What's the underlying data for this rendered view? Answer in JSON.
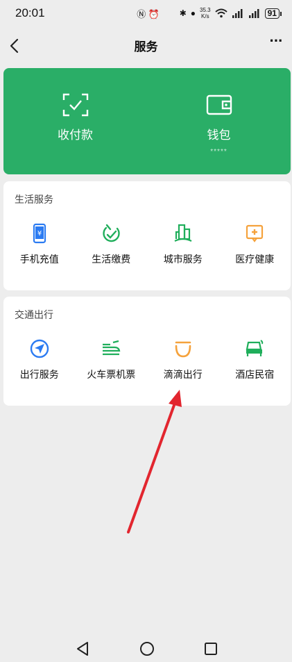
{
  "status_bar": {
    "time": "20:01",
    "nfc_alarm": "Ⓝ ⏰",
    "speed_value": "35.3",
    "speed_unit": "K/s",
    "battery": "91"
  },
  "nav": {
    "title": "服务",
    "more": "···"
  },
  "pay_card": {
    "items": [
      {
        "label": "收付款",
        "icon": "scan-icon",
        "sub": ""
      },
      {
        "label": "钱包",
        "icon": "wallet-icon",
        "sub": "*****"
      }
    ]
  },
  "life_service": {
    "title": "生活服务",
    "items": [
      {
        "label": "手机充值",
        "icon": "phone-recharge-icon"
      },
      {
        "label": "生活缴费",
        "icon": "bill-payment-icon"
      },
      {
        "label": "城市服务",
        "icon": "city-service-icon"
      },
      {
        "label": "医疗健康",
        "icon": "medical-icon"
      }
    ]
  },
  "transport": {
    "title": "交通出行",
    "items": [
      {
        "label": "出行服务",
        "icon": "navigation-icon"
      },
      {
        "label": "火车票机票",
        "icon": "train-ticket-icon"
      },
      {
        "label": "滴滴出行",
        "icon": "didi-icon"
      },
      {
        "label": "酒店民宿",
        "icon": "hotel-icon"
      }
    ]
  },
  "colors": {
    "green": "#2aae67",
    "blue": "#2b7bf2",
    "orange": "#f5a23c",
    "green_icon": "#1fae5b",
    "arrow": "#e2262f"
  }
}
